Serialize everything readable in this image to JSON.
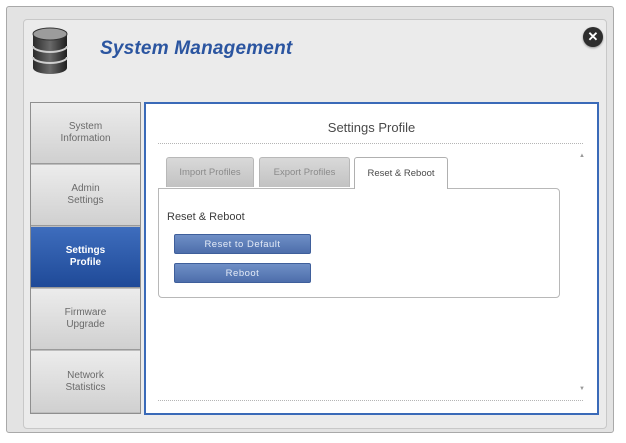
{
  "header": {
    "title": "System Management",
    "icon": "database-icon",
    "close_icon": "close-icon"
  },
  "sidebar": {
    "items": [
      {
        "label": "System\nInformation",
        "active": false
      },
      {
        "label": "Admin\nSettings",
        "active": false
      },
      {
        "label": "Settings\nProfile",
        "active": true
      },
      {
        "label": "Firmware\nUpgrade",
        "active": false
      },
      {
        "label": "Network\nStatistics",
        "active": false
      }
    ]
  },
  "main": {
    "section_title": "Settings Profile",
    "tabs": [
      {
        "label": "Import Profiles",
        "active": false
      },
      {
        "label": "Export Profiles",
        "active": false
      },
      {
        "label": "Reset & Reboot",
        "active": true
      }
    ],
    "panel": {
      "heading": "Reset & Reboot",
      "reset_label": "Reset to Default",
      "reboot_label": "Reboot"
    }
  },
  "colors": {
    "accent": "#2b55a0",
    "active_nav": "#2d5aa8",
    "button": "#5a7bb8",
    "content_border": "#3a6ab8"
  }
}
